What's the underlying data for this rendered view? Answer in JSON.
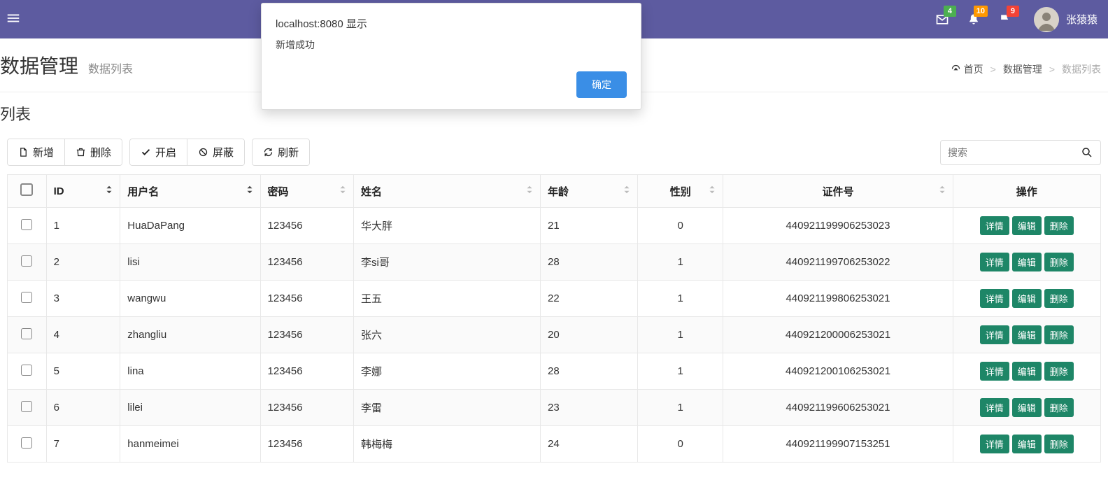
{
  "navbar": {
    "badges": {
      "mail": "4",
      "bell": "10",
      "flag": "9"
    },
    "user_name": "张猿猿"
  },
  "header": {
    "title": "数据管理",
    "subtitle": "数据列表"
  },
  "crumbs": {
    "home": "首页",
    "mid": "数据管理",
    "last": "数据列表"
  },
  "section_title": "列表",
  "toolbar": {
    "add": "新增",
    "delete": "删除",
    "enable": "开启",
    "block": "屏蔽",
    "refresh": "刷新"
  },
  "search": {
    "placeholder": "搜索"
  },
  "columns": {
    "id": "ID",
    "username": "用户名",
    "password": "密码",
    "name": "姓名",
    "age": "年龄",
    "sex": "性别",
    "cert": "证件号",
    "ops": "操作"
  },
  "actions": {
    "detail": "详情",
    "edit": "编辑",
    "delete": "删除"
  },
  "rows": [
    {
      "id": "1",
      "username": "HuaDaPang",
      "password": "123456",
      "name": "华大胖",
      "age": "21",
      "sex": "0",
      "cert": "440921199906253023"
    },
    {
      "id": "2",
      "username": "lisi",
      "password": "123456",
      "name": "李si哥",
      "age": "28",
      "sex": "1",
      "cert": "440921199706253022"
    },
    {
      "id": "3",
      "username": "wangwu",
      "password": "123456",
      "name": "王五",
      "age": "22",
      "sex": "1",
      "cert": "440921199806253021"
    },
    {
      "id": "4",
      "username": "zhangliu",
      "password": "123456",
      "name": "张六",
      "age": "20",
      "sex": "1",
      "cert": "440921200006253021"
    },
    {
      "id": "5",
      "username": "lina",
      "password": "123456",
      "name": "李娜",
      "age": "28",
      "sex": "1",
      "cert": "440921200106253021"
    },
    {
      "id": "6",
      "username": "lilei",
      "password": "123456",
      "name": "李雷",
      "age": "23",
      "sex": "1",
      "cert": "440921199606253021"
    },
    {
      "id": "7",
      "username": "hanmeimei",
      "password": "123456",
      "name": "韩梅梅",
      "age": "24",
      "sex": "0",
      "cert": "440921199907153251"
    }
  ],
  "dialog": {
    "title": "localhost:8080 显示",
    "message": "新增成功",
    "ok": "确定"
  }
}
